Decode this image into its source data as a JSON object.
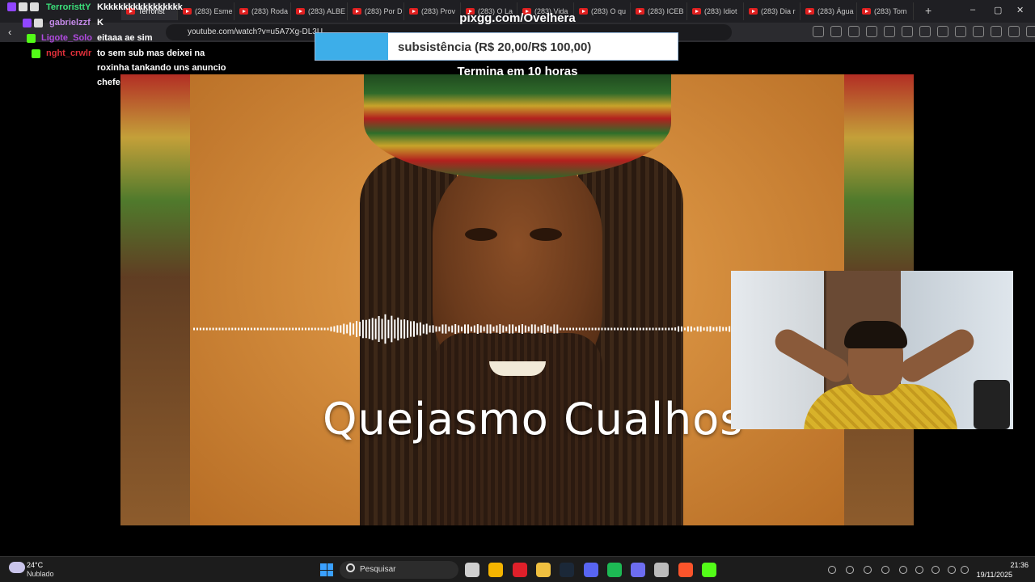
{
  "browser": {
    "tabs": [
      {
        "label": "Terrorist"
      },
      {
        "label": "(283) Esme"
      },
      {
        "label": "(283) Roda"
      },
      {
        "label": "(283) ALBE"
      },
      {
        "label": "(283) Por D"
      },
      {
        "label": "(283) Prov"
      },
      {
        "label": "(283) O La"
      },
      {
        "label": "(283) Vida"
      },
      {
        "label": "(283) O qu"
      },
      {
        "label": "(283) ICEB"
      },
      {
        "label": "(283) Idiot"
      },
      {
        "label": "(283) Dia r"
      },
      {
        "label": "(283) Água"
      },
      {
        "label": "(283) Tom"
      }
    ],
    "new_tab": "+",
    "url": "youtube.com/watch?v=u5A7Xg-DL3U",
    "window_controls": {
      "minimize": "–",
      "maximize": "▢",
      "close": "✕"
    }
  },
  "chat": {
    "messages": [
      {
        "user": "TerroristtY",
        "text": "Kkkkkkkkkkkkkkkkk",
        "user_color": "#3be07a"
      },
      {
        "user": "gabrielzzf",
        "text": "K",
        "user_color": "#c48ae8"
      },
      {
        "user": "Ligote_Solo",
        "text": "eitaaa ae sim",
        "user_color": "#b04ae0"
      },
      {
        "user": "nght_crwlr",
        "text": "to sem sub mas deixei na roxinha tankando uns anuncio chefe",
        "user_color": "#e0303a"
      }
    ],
    "message_lines": [
      "to sem sub mas deixei na",
      "roxinha tankando uns anuncio",
      "chefe"
    ]
  },
  "goal": {
    "site": "pixgg.com/Ovelhera",
    "label": "subsistência (R$ 20,00/R$ 100,00)",
    "current": 20,
    "target": 100,
    "progress": 0.2,
    "ends": "Termina em 10 horas",
    "bar_color": "#3daee9"
  },
  "video": {
    "caption": "Quejasmo Cualhos"
  },
  "taskbar": {
    "weather_temp": "24°C",
    "weather_desc": "Nublado",
    "search_placeholder": "Pesquisar",
    "time": "21:36",
    "date": "19/11/2025",
    "apps": [
      "file-explorer",
      "chrome",
      "opera",
      "folder",
      "steam",
      "discord",
      "spotify",
      "app",
      "app",
      "brave",
      "kick"
    ]
  }
}
